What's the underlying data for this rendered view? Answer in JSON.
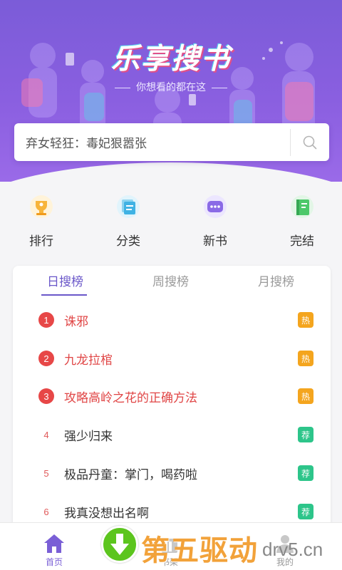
{
  "header": {
    "logo_text": "乐享搜书",
    "slogan": "你想看的都在这"
  },
  "search": {
    "value": "弃女轻狂：毒妃狠嚣张",
    "icon": "search-icon"
  },
  "categories": [
    {
      "label": "排行",
      "icon": "trophy-icon"
    },
    {
      "label": "分类",
      "icon": "category-icon"
    },
    {
      "label": "新书",
      "icon": "new-book-icon"
    },
    {
      "label": "完结",
      "icon": "finished-book-icon"
    }
  ],
  "tabs": [
    {
      "label": "日搜榜",
      "active": true
    },
    {
      "label": "周搜榜",
      "active": false
    },
    {
      "label": "月搜榜",
      "active": false
    }
  ],
  "ranking": [
    {
      "rank": "1",
      "title": "诛邪",
      "badge": "热",
      "badge_type": "hot"
    },
    {
      "rank": "2",
      "title": "九龙拉棺",
      "badge": "热",
      "badge_type": "hot"
    },
    {
      "rank": "3",
      "title": "攻略高岭之花的正确方法",
      "badge": "热",
      "badge_type": "hot"
    },
    {
      "rank": "4",
      "title": "强少归来",
      "badge": "荐",
      "badge_type": "rec"
    },
    {
      "rank": "5",
      "title": "极品丹童：掌门，喝药啦",
      "badge": "荐",
      "badge_type": "rec"
    },
    {
      "rank": "6",
      "title": "我真没想出名啊",
      "badge": "荐",
      "badge_type": "rec"
    }
  ],
  "bottom_nav": [
    {
      "label": "首页",
      "icon": "home-icon",
      "active": true
    },
    {
      "label": "书架",
      "icon": "bookshelf-icon",
      "active": false
    },
    {
      "label": "我的",
      "icon": "user-icon",
      "active": false
    }
  ],
  "watermark": {
    "text": "第五驱动",
    "domain": "drv5.cn"
  },
  "colors": {
    "brand_purple": "#7b5cd8",
    "accent_purple": "#6a57c9",
    "hot_red": "#e74747",
    "hot_badge": "#f4a51e",
    "rec_badge": "#2dc58a"
  }
}
